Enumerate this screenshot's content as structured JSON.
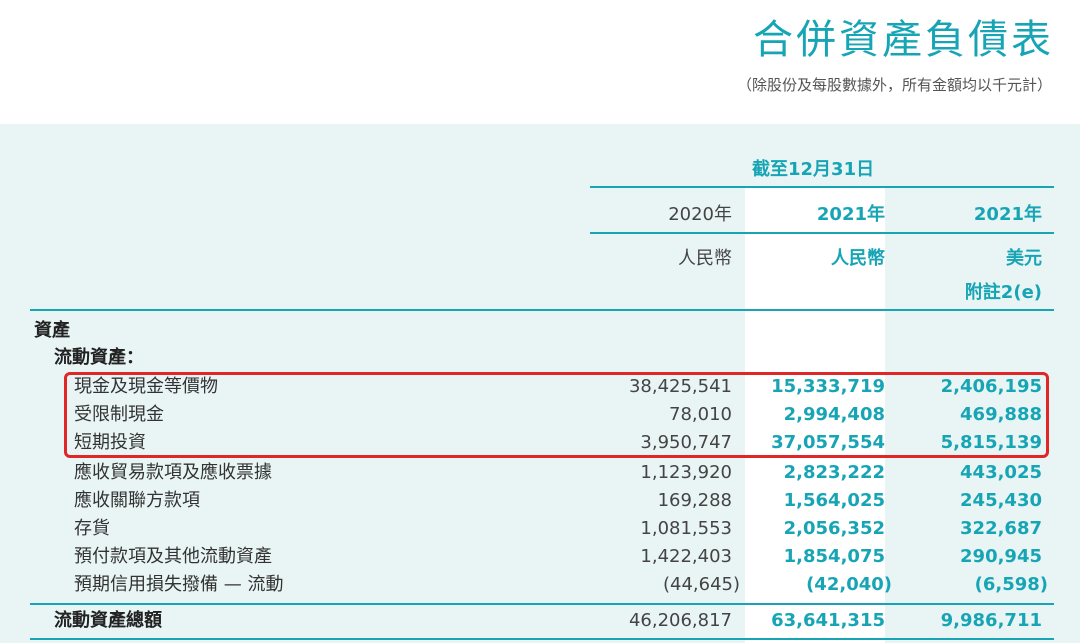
{
  "title": "合併資產負債表",
  "subtitle": "（除股份及每股數據外，所有金額均以千元計）",
  "header": {
    "period": "截至12月31日",
    "col1_year": "2020年",
    "col2_year": "2021年",
    "col3_year": "2021年",
    "col1_currency": "人民幣",
    "col2_currency": "人民幣",
    "col3_currency": "美元",
    "col3_note": "附註2(e)"
  },
  "sections": {
    "assets": "資產",
    "current_assets": "流動資產："
  },
  "rows": [
    {
      "label": "現金及現金等價物",
      "y2020": "38,425,541",
      "y2021_rmb": "15,333,719",
      "y2021_usd": "2,406,195"
    },
    {
      "label": "受限制現金",
      "y2020": "78,010",
      "y2021_rmb": "2,994,408",
      "y2021_usd": "469,888"
    },
    {
      "label": "短期投資",
      "y2020": "3,950,747",
      "y2021_rmb": "37,057,554",
      "y2021_usd": "5,815,139"
    },
    {
      "label": "應收貿易款項及應收票據",
      "y2020": "1,123,920",
      "y2021_rmb": "2,823,222",
      "y2021_usd": "443,025"
    },
    {
      "label": "應收關聯方款項",
      "y2020": "169,288",
      "y2021_rmb": "1,564,025",
      "y2021_usd": "245,430"
    },
    {
      "label": "存貨",
      "y2020": "1,081,553",
      "y2021_rmb": "2,056,352",
      "y2021_usd": "322,687"
    },
    {
      "label": "預付款項及其他流動資產",
      "y2020": "1,422,403",
      "y2021_rmb": "1,854,075",
      "y2021_usd": "290,945"
    },
    {
      "label": "預期信用損失撥備 — 流動",
      "y2020": "(44,645)",
      "y2021_rmb": "(42,040)",
      "y2021_usd": "(6,598)"
    }
  ],
  "total": {
    "label": "流動資產總額",
    "y2020": "46,206,817",
    "y2021_rmb": "63,641,315",
    "y2021_usd": "9,986,711"
  },
  "colors": {
    "accent": "#17a5b5",
    "panel": "#e9f5f5",
    "highlight": "#e02626"
  }
}
